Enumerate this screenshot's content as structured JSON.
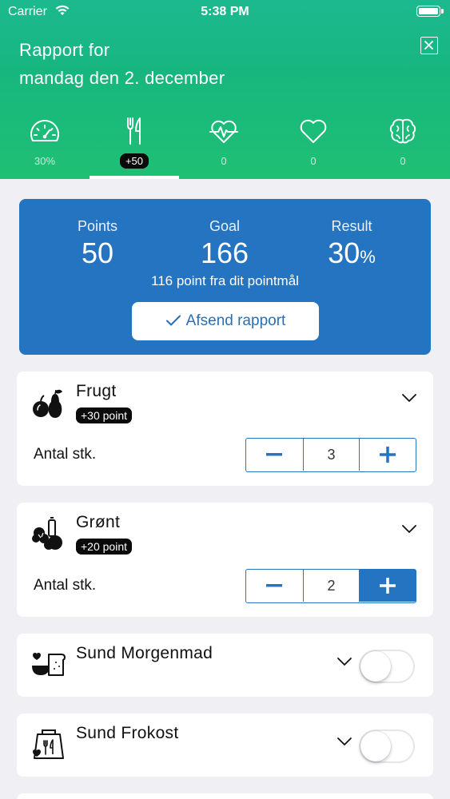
{
  "status_bar": {
    "carrier": "Carrier",
    "time": "5:38 PM"
  },
  "header": {
    "title_line1": "Rapport for",
    "title_line2": "mandag den 2. december"
  },
  "tabs": [
    {
      "icon": "speedometer-icon",
      "label": "30%"
    },
    {
      "icon": "fork-knife-icon",
      "label": "+50",
      "active": true
    },
    {
      "icon": "heartbeat-icon",
      "label": "0"
    },
    {
      "icon": "heart-icon",
      "label": "0"
    },
    {
      "icon": "brain-icon",
      "label": "0"
    }
  ],
  "summary": {
    "points_label": "Points",
    "points_value": "50",
    "goal_label": "Goal",
    "goal_value": "166",
    "result_label": "Result",
    "result_value": "30",
    "result_unit": "%",
    "note": "116 point fra dit pointmål",
    "send_label": "Afsend rapport"
  },
  "items": [
    {
      "name": "Frugt",
      "badge": "+30 point",
      "qty_label": "Antal stk.",
      "qty": "3",
      "icon": "fruit-icon"
    },
    {
      "name": "Grønt",
      "badge": "+20 point",
      "qty_label": "Antal stk.",
      "qty": "2",
      "icon": "vegetables-icon"
    },
    {
      "name": "Sund Morgenmad",
      "icon": "breakfast-icon",
      "toggle_on": false
    },
    {
      "name": "Sund Frokost",
      "icon": "lunch-bag-icon",
      "toggle_on": false
    }
  ],
  "colors": {
    "header_green": "#1cb98f",
    "accent_blue": "#2474c1",
    "badge_black": "#0a0a0a"
  }
}
